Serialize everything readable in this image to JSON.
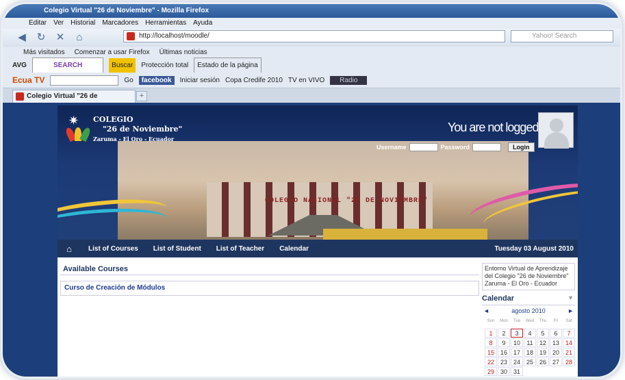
{
  "window": {
    "title": "Colegio Virtual \"26 de Noviembre\" - Mozilla Firefox"
  },
  "menu": [
    "Editar",
    "Ver",
    "Historial",
    "Marcadores",
    "Herramientas",
    "Ayuda"
  ],
  "url": "http://localhost/moodle/",
  "search_placeholder": "Yahoo! Search",
  "bookmarks": [
    "Más visitados",
    "Comenzar a usar Firefox",
    "Últimas noticias"
  ],
  "avg_toolbar": {
    "label": "AVG",
    "search": "SEARCH",
    "buscar": "Buscar",
    "proteccion": "Protección total",
    "estado": "Estado de la página"
  },
  "ecua_toolbar": {
    "label": "Ecua TV",
    "go": "Go",
    "facebook": "facebook",
    "iniciar": "Iniciar sesión",
    "copa": "Copa Credife 2010",
    "tvvivo": "TV en VIVO",
    "radio": "Radio"
  },
  "tab": {
    "label": "Colegio Virtual \"26 de Noviembre\""
  },
  "site": {
    "colegio_line1": "COLEGIO",
    "colegio_line2": "\"26 de Noviembre\"",
    "colegio_line3": "Zaruma - El Oro - Ecuador",
    "not_logged": "You are not logged in.",
    "username_label": "Username",
    "password_label": "Password",
    "login_button": "Login",
    "building_sign": "COLEGIO NACIONAL \"26 DE NOVIEMBRE\""
  },
  "nav": {
    "items": [
      "List of Courses",
      "List of Student",
      "List of Teacher",
      "Calendar"
    ],
    "date": "Tuesday 03 August 2010"
  },
  "content": {
    "available": "Available Courses",
    "course": "Curso de Creación de Módulos"
  },
  "sidebar": {
    "entorno": "Entorno Virtual de Aprendizaje del Colegio \"26 de Noviembre\" Zaruma - El Oro - Ecuador"
  },
  "calendar": {
    "title": "Calendar",
    "month": "agosto 2010",
    "dow": [
      "Sun",
      "Mon",
      "Tue",
      "Wed",
      "Thu",
      "Fri",
      "Sat"
    ],
    "days": [
      1,
      2,
      3,
      4,
      5,
      6,
      7,
      8,
      9,
      10,
      11,
      12,
      13,
      14,
      15,
      16,
      17,
      18,
      19,
      20,
      21,
      22,
      23,
      24,
      25,
      26,
      27,
      28,
      29,
      30,
      31
    ],
    "today": 3
  }
}
